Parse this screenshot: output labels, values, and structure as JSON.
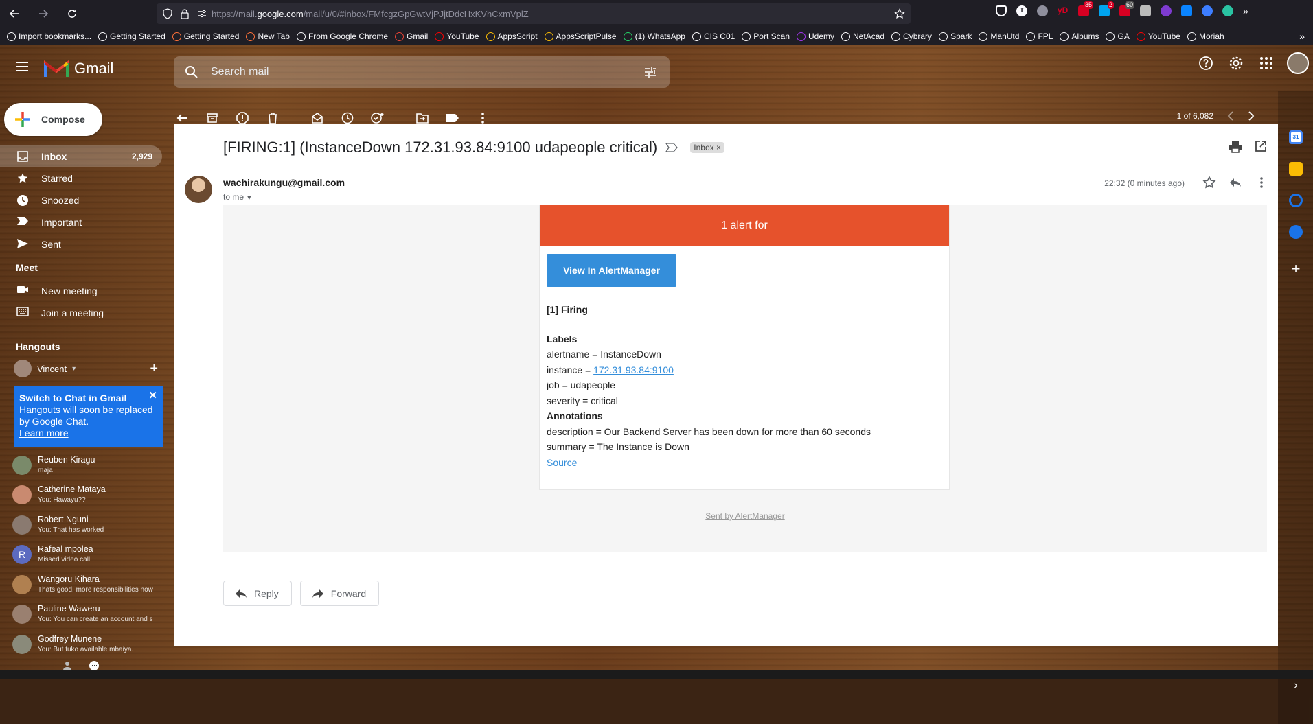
{
  "browser": {
    "url_prefix": "https://mail.",
    "url_domain": "google.com",
    "url_suffix": "/mail/u/0/#inbox/FMfcgzGpGwtVjPJjtDdcHxKVhCxmVplZ",
    "ext_badges": [
      "35",
      "2",
      "60"
    ],
    "bookmarks": [
      {
        "label": "Import bookmarks...",
        "color": "#fbfbfe"
      },
      {
        "label": "Getting Started",
        "color": "#fbfbfe"
      },
      {
        "label": "Getting Started",
        "color": "#ff7139"
      },
      {
        "label": "New Tab",
        "color": "#ff7139"
      },
      {
        "label": "From Google Chrome",
        "color": "#fbfbfe"
      },
      {
        "label": "Gmail",
        "color": "#ea4335"
      },
      {
        "label": "YouTube",
        "color": "#ff0000"
      },
      {
        "label": "AppsScript",
        "color": "#fbbc04"
      },
      {
        "label": "AppsScriptPulse",
        "color": "#fbbc04"
      },
      {
        "label": "(1) WhatsApp",
        "color": "#25d366"
      },
      {
        "label": "CIS C01",
        "color": "#fbfbfe"
      },
      {
        "label": "Port Scan",
        "color": "#fbfbfe"
      },
      {
        "label": "Udemy",
        "color": "#a435f0"
      },
      {
        "label": "NetAcad",
        "color": "#fbfbfe"
      },
      {
        "label": "Cybrary",
        "color": "#fbfbfe"
      },
      {
        "label": "Spark",
        "color": "#fbfbfe"
      },
      {
        "label": "ManUtd",
        "color": "#fbfbfe"
      },
      {
        "label": "FPL",
        "color": "#fbfbfe"
      },
      {
        "label": "Albums",
        "color": "#fbfbfe"
      },
      {
        "label": "GA",
        "color": "#fbfbfe"
      },
      {
        "label": "YouTube",
        "color": "#ff0000"
      },
      {
        "label": "Moriah",
        "color": "#fbfbfe"
      }
    ]
  },
  "header": {
    "app_name": "Gmail",
    "search_placeholder": "Search mail"
  },
  "sidebar": {
    "compose_label": "Compose",
    "items": [
      {
        "label": "Inbox",
        "count": "2,929",
        "icon": "inbox-icon"
      },
      {
        "label": "Starred",
        "count": "",
        "icon": "star-icon"
      },
      {
        "label": "Snoozed",
        "count": "",
        "icon": "clock-icon"
      },
      {
        "label": "Important",
        "count": "",
        "icon": "important-icon"
      },
      {
        "label": "Sent",
        "count": "",
        "icon": "send-icon"
      }
    ],
    "meet_title": "Meet",
    "meet_items": [
      {
        "label": "New meeting",
        "icon": "video-icon"
      },
      {
        "label": "Join a meeting",
        "icon": "keyboard-icon"
      }
    ],
    "hangouts_title": "Hangouts",
    "hangouts_user": "Vincent",
    "chat_card": {
      "title": "Switch to Chat in Gmail",
      "text": "Hangouts will soon be replaced by Google Chat.",
      "link": "Learn more"
    },
    "contacts": [
      {
        "name": "Reuben Kiragu",
        "msg": "maja",
        "color": "#7a8a6a"
      },
      {
        "name": "Catherine Mataya",
        "msg": "You: Hawayu??",
        "color": "#c98a70"
      },
      {
        "name": "Robert Nguni",
        "msg": "You: That has worked",
        "color": "#8a7a70"
      },
      {
        "name": "Rafeal mpolea",
        "msg": "Missed video call",
        "color": "#5c6bc0",
        "initial": "R"
      },
      {
        "name": "Wangoru Kihara",
        "msg": "Thats good, more responsibilities now",
        "color": "#b08050"
      },
      {
        "name": "Pauline Waweru",
        "msg": "You: You can create an account and s",
        "color": "#9a8070"
      },
      {
        "name": "Godfrey Munene",
        "msg": "You: But tuko available mbaiya.",
        "color": "#8a8a7a"
      }
    ]
  },
  "toolbar": {
    "pager": "1 of 6,082"
  },
  "email": {
    "subject": "[FIRING:1] (InstanceDown 172.31.93.84:9100 udapeople critical)",
    "label_chip": "Inbox",
    "sender": "wachirakungu@gmail.com",
    "to": "to me",
    "time": "22:32 (0 minutes ago)",
    "alert_header": "1 alert for",
    "button": "View In AlertManager",
    "firing": "[1] Firing",
    "labels_title": "Labels",
    "alertname": "alertname = InstanceDown",
    "instance_prefix": "instance = ",
    "instance_link": "172.31.93.84:9100",
    "job": "job = udapeople",
    "severity": "severity = critical",
    "annotations_title": "Annotations",
    "description": "description = Our Backend Server has been down for more than 60 seconds",
    "summary": "summary = The Instance is Down",
    "source": "Source",
    "sent_by": "Sent by AlertManager",
    "reply": "Reply",
    "forward": "Forward"
  }
}
